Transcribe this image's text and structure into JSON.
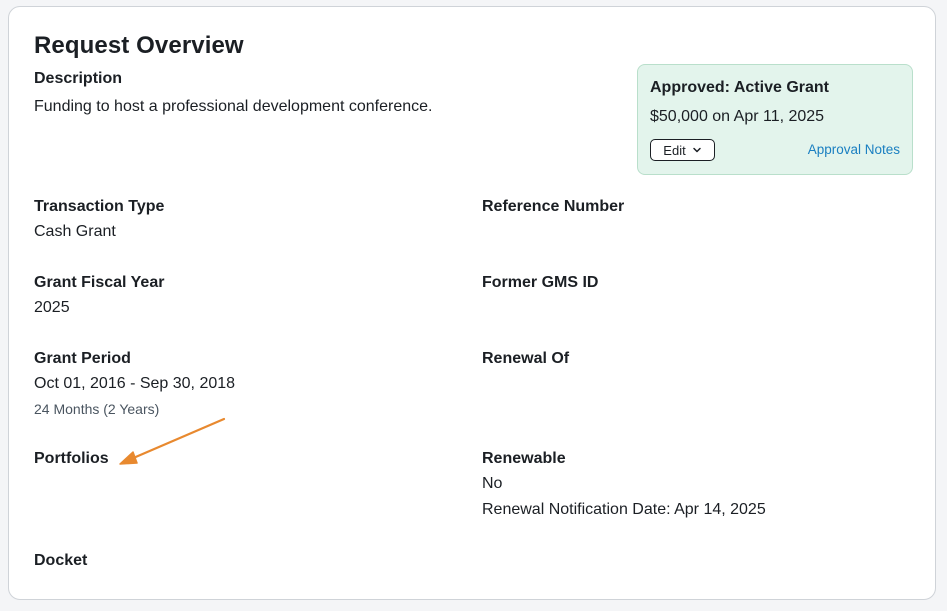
{
  "page": {
    "title": "Request Overview"
  },
  "description": {
    "label": "Description",
    "value": "Funding to host a professional development conference."
  },
  "status": {
    "title": "Approved: Active Grant",
    "amount": "$50,000 on Apr 11, 2025",
    "edit_label": "Edit",
    "notes_label": "Approval Notes",
    "accent_bg": "#e3f4ec",
    "link_color": "#1a7fc1"
  },
  "fields": {
    "transaction_type": {
      "label": "Transaction Type",
      "value": "Cash Grant"
    },
    "reference_number": {
      "label": "Reference Number",
      "value": ""
    },
    "grant_fiscal_year": {
      "label": "Grant Fiscal Year",
      "value": "2025"
    },
    "former_gms_id": {
      "label": "Former GMS ID",
      "value": ""
    },
    "grant_period": {
      "label": "Grant Period",
      "value": "Oct 01, 2016 - Sep 30, 2018",
      "duration": "24 Months (2 Years)"
    },
    "renewal_of": {
      "label": "Renewal Of",
      "value": ""
    },
    "portfolios": {
      "label": "Portfolios",
      "value": ""
    },
    "renewable": {
      "label": "Renewable",
      "value": "No",
      "notification": "Renewal Notification Date: Apr 14, 2025"
    },
    "docket": {
      "label": "Docket",
      "value": ""
    }
  },
  "annotation": {
    "arrow_color": "#e8892f"
  }
}
